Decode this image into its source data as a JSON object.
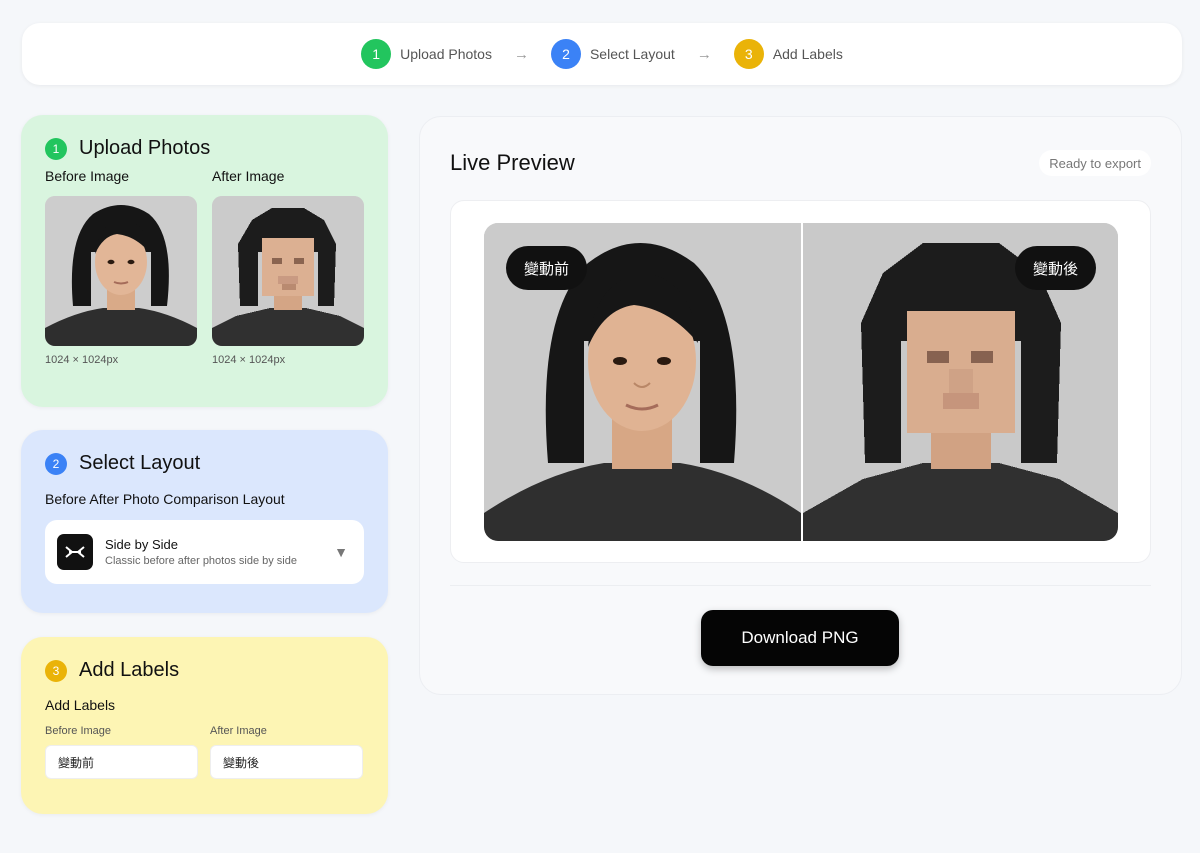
{
  "stepper": {
    "steps": [
      {
        "num": "1",
        "label": "Upload Photos",
        "color": "#22c55e"
      },
      {
        "num": "2",
        "label": "Select Layout",
        "color": "#3b82f6"
      },
      {
        "num": "3",
        "label": "Add Labels",
        "color": "#eab308"
      }
    ],
    "arrow": "→"
  },
  "upload": {
    "num": "1",
    "title": "Upload Photos",
    "before_label": "Before Image",
    "after_label": "After Image",
    "before_size": "1024 × 1024px",
    "after_size": "1024 × 1024px"
  },
  "layout": {
    "num": "2",
    "title": "Select Layout",
    "subtitle": "Before After Photo Comparison Layout",
    "selected_name": "Side by Side",
    "selected_desc": "Classic before after photos side by side",
    "caret": "▼"
  },
  "labels": {
    "num": "3",
    "title": "Add Labels",
    "subtitle": "Add Labels",
    "before_field_label": "Before Image",
    "after_field_label": "After Image",
    "before_value": "變動前",
    "after_value": "變動後"
  },
  "preview": {
    "title": "Live Preview",
    "status": "Ready to export",
    "before_pill": "變動前",
    "after_pill": "變動後",
    "download_label": "Download PNG"
  },
  "colors": {
    "green": "#22c55e",
    "blue": "#3b82f6",
    "yellow": "#eab308"
  }
}
